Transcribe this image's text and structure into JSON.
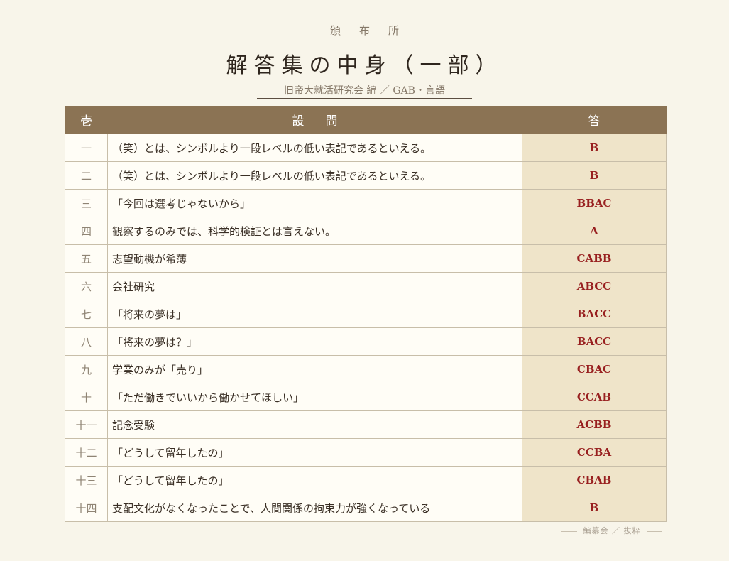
{
  "header": {
    "kicker": "頒布所",
    "title": "解答集の中身（一部）",
    "subtitle": "旧帝大就活研究会 編 ／ GAB・言語"
  },
  "table": {
    "headers": {
      "number": "壱",
      "question": "設問",
      "answer": "答"
    },
    "rows": [
      {
        "number": "一",
        "question": "（笑）とは、シンボルより一段レベルの低い表記であるといえる。",
        "answer": "B"
      },
      {
        "number": "二",
        "question": "（笑）とは、シンボルより一段レベルの低い表記であるといえる。",
        "answer": "B"
      },
      {
        "number": "三",
        "question": "「今回は選考じゃないから」",
        "answer": "BBAC"
      },
      {
        "number": "四",
        "question": "観察するのみでは、科学的検証とは言えない。",
        "answer": "A"
      },
      {
        "number": "五",
        "question": "志望動機が希薄",
        "answer": "CABB"
      },
      {
        "number": "六",
        "question": "会社研究",
        "answer": "ABCC"
      },
      {
        "number": "七",
        "question": "「将来の夢は」",
        "answer": "BACC"
      },
      {
        "number": "八",
        "question": "「将来の夢は？」",
        "answer": "BACC"
      },
      {
        "number": "九",
        "question": "学業のみが「売り」",
        "answer": "CBAC"
      },
      {
        "number": "十",
        "question": "「ただ働きでいいから働かせてほしい」",
        "answer": "CCAB"
      },
      {
        "number": "十一",
        "question": "記念受験",
        "answer": "ACBB"
      },
      {
        "number": "十二",
        "question": "「どうして留年したの」",
        "answer": "CCBA"
      },
      {
        "number": "十三",
        "question": "「どうして留年したの」",
        "answer": "CBAB"
      },
      {
        "number": "十四",
        "question": "支配文化がなくなったことで、人間関係の拘束力が強くなっている",
        "answer": "B"
      }
    ]
  },
  "footer": {
    "text": "編纂会 ／ 抜粋"
  },
  "colors": {
    "page_background": "#f8f5ea",
    "header_row": "#8b7354",
    "answer_column": "#efe4c9",
    "answer_text": "#981f1f"
  }
}
